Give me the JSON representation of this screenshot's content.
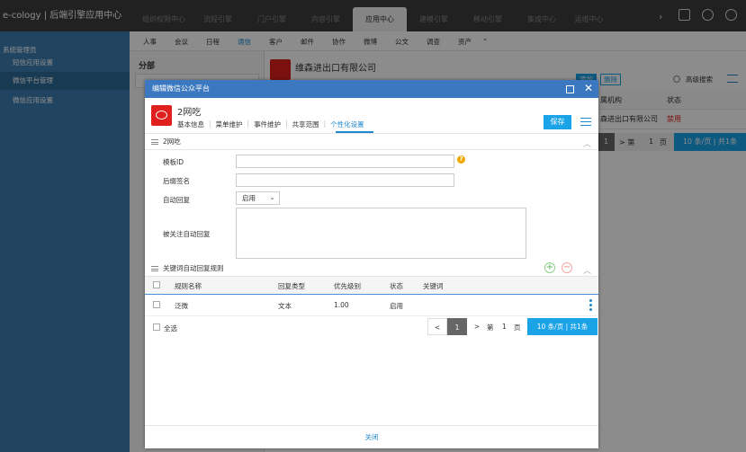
{
  "app": {
    "brand": "e-cology | 后端引擎应用中心"
  },
  "topnav": {
    "tabs": [
      "组织权限中心",
      "流程引擎",
      "门户引擎",
      "内容引擎",
      "应用中心",
      "建模引擎",
      "移动引擎",
      "集成中心",
      "运维中心"
    ],
    "active_index": 4,
    "more": "›"
  },
  "sidebar": {
    "header": "系统管理员",
    "items": [
      "短信应用设置",
      "微信平台管理",
      "微信应用设置"
    ],
    "active_index": 1
  },
  "subnav": {
    "items": [
      "人事",
      "会议",
      "日程",
      "通信",
      "客户",
      "邮件",
      "协作",
      "微博",
      "公文",
      "调查",
      "资产"
    ],
    "active_index": 3,
    "more": "⌄"
  },
  "left_panel": {
    "title": "分部"
  },
  "company": {
    "name": "维森进出口有限公司"
  },
  "grid": {
    "add_label": "添加",
    "delete_label": "删除",
    "advanced_search": "高级搜索",
    "columns": [
      "属机构",
      "状态"
    ],
    "row": {
      "org": "森进出口有限公司",
      "status": "禁用"
    },
    "pager": {
      "page": "1",
      "goto": "> 第",
      "page_val": "1",
      "page_unit": "页",
      "info": "10  条/页 | 共1条"
    }
  },
  "dialog": {
    "title": "编辑微信公众平台",
    "name": "2网吃",
    "tabs": [
      "基本信息",
      "菜单维护",
      "事件维护",
      "共享范围",
      "个性化设置"
    ],
    "active_tab": 4,
    "save_label": "保存",
    "section1": {
      "title": "2网吃",
      "fields": {
        "template_id_label": "模板ID",
        "template_id_value": "",
        "suffix_label": "后缀签名",
        "suffix_value": "",
        "auto_reply_label": "自动回复",
        "auto_reply_value": "启用",
        "follow_reply_label": "被关注自动回复",
        "follow_reply_value": ""
      }
    },
    "section2": {
      "title": "关键词自动回复规则",
      "columns": [
        "规则名称",
        "回复类型",
        "优先级别",
        "状态",
        "关键词"
      ],
      "rows": [
        {
          "name": "泛微",
          "type": "文本",
          "priority": "1.00",
          "status": "启用",
          "keyword": ""
        }
      ],
      "select_all": "全选",
      "pager": {
        "prev": "<",
        "page": "1",
        "next": ">",
        "go_label": "第",
        "go_value": "1",
        "page_unit": "页",
        "info": "10  条/页 | 共1条"
      }
    },
    "close_label": "关闭"
  },
  "colors": {
    "primary": "#1e88d0",
    "sidebar": "#3d7eaf",
    "title_bar": "#3b78c0",
    "danger": "#e0201d"
  }
}
